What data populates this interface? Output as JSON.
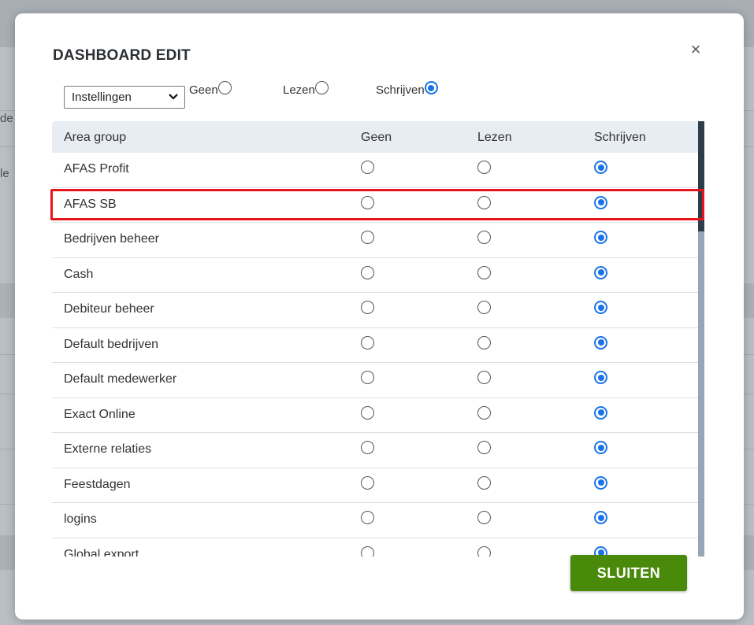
{
  "background": {
    "left_texts": [
      "de",
      "le"
    ]
  },
  "modal": {
    "title": "DASHBOARD EDIT",
    "close_symbol": "×",
    "filter": {
      "selected": "Instellingen",
      "options": [
        {
          "label": "Geen",
          "checked": false
        },
        {
          "label": "Lezen",
          "checked": false
        },
        {
          "label": "Schrijven",
          "checked": true
        }
      ]
    },
    "table": {
      "headers": [
        "Area group",
        "Geen",
        "Lezen",
        "Schrijven"
      ],
      "rows": [
        {
          "name": "AFAS Profit",
          "value": "Schrijven"
        },
        {
          "name": "AFAS SB",
          "value": "Schrijven",
          "highlighted": true
        },
        {
          "name": "Bedrijven beheer",
          "value": "Schrijven"
        },
        {
          "name": "Cash",
          "value": "Schrijven"
        },
        {
          "name": "Debiteur beheer",
          "value": "Schrijven"
        },
        {
          "name": "Default bedrijven",
          "value": "Schrijven"
        },
        {
          "name": "Default medewerker",
          "value": "Schrijven"
        },
        {
          "name": "Exact Online",
          "value": "Schrijven"
        },
        {
          "name": "Externe relaties",
          "value": "Schrijven"
        },
        {
          "name": "Feestdagen",
          "value": "Schrijven"
        },
        {
          "name": "logins",
          "value": "Schrijven"
        },
        {
          "name": "Global export",
          "value": "Schrijven"
        }
      ]
    },
    "close_button_label": "SLUITEN"
  },
  "colors": {
    "accent_radio": "#1a73e8",
    "primary_button": "#4a8a0b",
    "highlight_border": "#e5151b",
    "header_bg": "#e8edf3"
  }
}
